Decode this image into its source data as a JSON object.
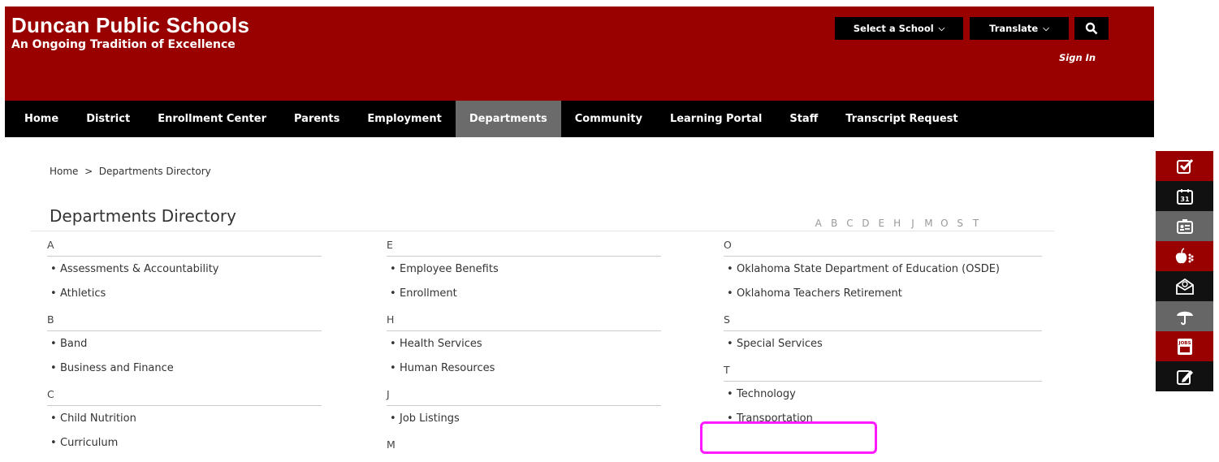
{
  "header": {
    "title": "Duncan Public Schools",
    "subtitle": "An Ongoing Tradition of Excellence",
    "select_school": "Select a School",
    "translate": "Translate",
    "sign_in": "Sign In"
  },
  "nav": {
    "items": [
      "Home",
      "District",
      "Enrollment Center",
      "Parents",
      "Employment",
      "Departments",
      "Community",
      "Learning Portal",
      "Staff",
      "Transcript Request"
    ],
    "active": "Departments"
  },
  "breadcrumb": "Home  >  Departments Directory",
  "page_title": "Departments Directory",
  "letters": [
    "A",
    "B",
    "C",
    "D",
    "E",
    "H",
    "J",
    "M",
    "O",
    "S",
    "T"
  ],
  "directory": {
    "col1": [
      {
        "section": "A",
        "items": [
          "Assessments & Accountability",
          "Athletics"
        ]
      },
      {
        "section": "B",
        "items": [
          "Band",
          "Business and Finance"
        ]
      },
      {
        "section": "C",
        "items": [
          "Child Nutrition",
          "Curriculum"
        ]
      }
    ],
    "col2": [
      {
        "section": "E",
        "items": [
          "Employee Benefits",
          "Enrollment"
        ]
      },
      {
        "section": "H",
        "items": [
          "Health Services",
          "Human Resources"
        ]
      },
      {
        "section": "J",
        "items": [
          "Job Listings"
        ]
      },
      {
        "section": "M",
        "items": []
      }
    ],
    "col3": [
      {
        "section": "O",
        "items": [
          "Oklahoma State Department of Education (OSDE)",
          "Oklahoma Teachers Retirement"
        ]
      },
      {
        "section": "S",
        "items": [
          "Special Services"
        ]
      },
      {
        "section": "T",
        "items": [
          "Technology",
          "Transportation"
        ]
      }
    ]
  },
  "sidebar_icons": [
    "checkbox-icon",
    "calendar-icon",
    "id-card-icon",
    "apple-icon",
    "email-icon",
    "umbrella-icon",
    "jobs-icon",
    "edit-icon"
  ],
  "calendar_day": "31",
  "jobs_label": "JOBS",
  "colors": {
    "brand_red": "#990000",
    "nav_black": "#000000",
    "nav_active": "#6b6b6b",
    "highlight": "#ff1aff"
  }
}
